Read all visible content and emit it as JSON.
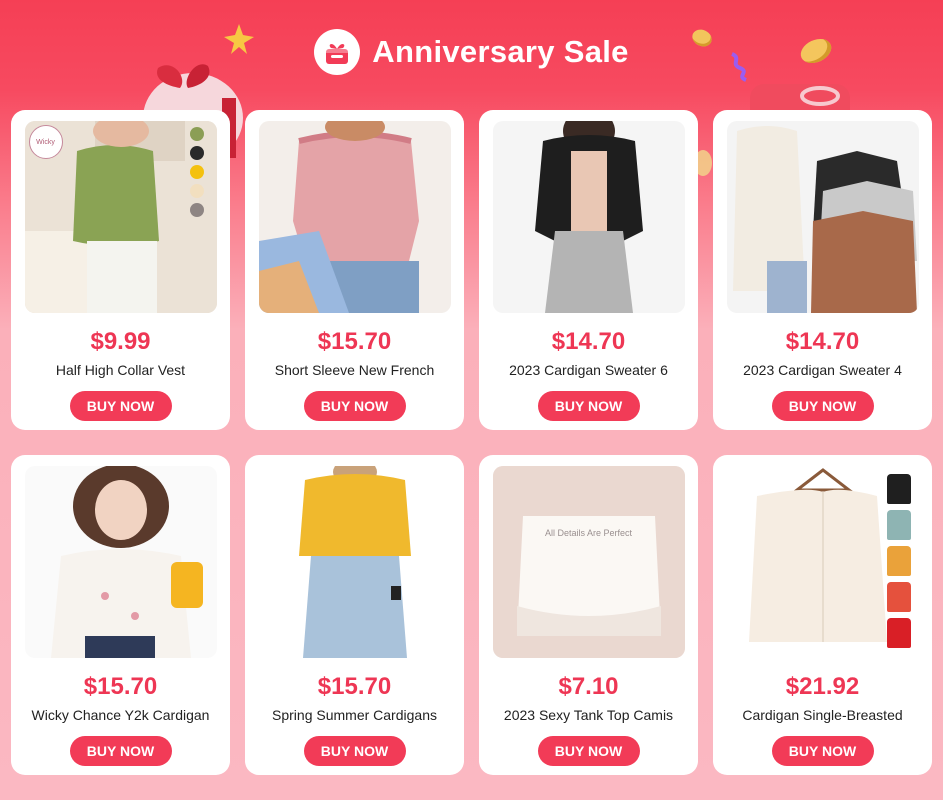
{
  "header": {
    "title": "Anniversary Sale",
    "icon": "gift-icon"
  },
  "colors": {
    "accent": "#f23b57",
    "price": "#ee3654",
    "background_top": "#f53f55",
    "background_bottom": "#fbb8c2"
  },
  "products": [
    {
      "price": "$9.99",
      "name": "Half High Collar Vest",
      "button": "BUY NOW",
      "badge": "Wicky"
    },
    {
      "price": "$15.70",
      "name": "Short Sleeve New French",
      "button": "BUY NOW"
    },
    {
      "price": "$14.70",
      "name": "2023 Cardigan Sweater 6",
      "button": "BUY NOW"
    },
    {
      "price": "$14.70",
      "name": "2023 Cardigan Sweater 4",
      "button": "BUY NOW"
    },
    {
      "price": "$15.70",
      "name": "Wicky Chance Y2k Cardigan",
      "button": "BUY NOW"
    },
    {
      "price": "$15.70",
      "name": "Spring Summer Cardigans",
      "button": "BUY NOW"
    },
    {
      "price": "$7.10",
      "name": "2023 Sexy Tank Top Camis",
      "button": "BUY NOW",
      "overlay": "All Details Are Perfect"
    },
    {
      "price": "$21.92",
      "name": "Cardigan Single-Breasted",
      "button": "BUY NOW"
    }
  ]
}
